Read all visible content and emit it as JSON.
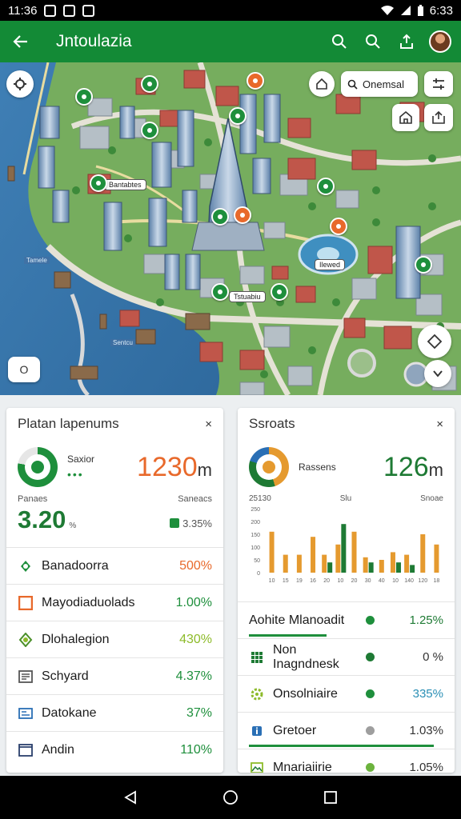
{
  "status_bar": {
    "time": "11:36",
    "clock_right": "6:33"
  },
  "app_bar": {
    "title": "Jntoulazia"
  },
  "map": {
    "search_label": "Onemsal",
    "zoom_label": "O",
    "labels": [
      "Bantabtes",
      "Tstuabiu",
      "Ilewed"
    ],
    "water_labels": [
      "Tamele",
      "Sentcu"
    ]
  },
  "left_card": {
    "title": "Platan lapenums",
    "close": "×",
    "summary_label": "Saxior",
    "summary_dots": "•••",
    "big_value": "1230",
    "big_unit": "m",
    "stat_left": "Panaes",
    "stat_right": "Saneacs",
    "kpi_value": "3.20",
    "kpi_suffix": "%",
    "kpi_right": "3.35%",
    "rows": [
      {
        "label": "Banadoorra",
        "value": "500%",
        "color": "#e8692b"
      },
      {
        "label": "Mayodiaduolads",
        "value": "1.00%",
        "color": "#1e8f3c"
      },
      {
        "label": "Dlohalegion",
        "value": "430%",
        "color": "#8dbb2a"
      },
      {
        "label": "Schyard",
        "value": "4.37%",
        "color": "#1e8f3c"
      },
      {
        "label": "Datokane",
        "value": "37%",
        "color": "#1e8f3c"
      },
      {
        "label": "Andin",
        "value": "110%",
        "color": "#1e8f3c"
      }
    ]
  },
  "right_card": {
    "title": "Ssroats",
    "close": "×",
    "summary_label": "Rassens",
    "big_value": "126",
    "big_unit": "m",
    "chart_head_left": "25130",
    "chart_head_mid": "Slu",
    "chart_head_right": "Snoae",
    "rows": [
      {
        "label": "Aohite Mlanoadit",
        "value": "1.25%",
        "dot": "#1e8f3c",
        "progress": 0.4
      },
      {
        "label": "Non Inagndnesk",
        "value": "0 %",
        "dot": "#1e7a34",
        "progress": 0
      },
      {
        "label": "Onsolniaire",
        "value": "335%",
        "dot": "#1e8f3c",
        "progress": 0
      },
      {
        "label": "Gretoer",
        "value": "1.03%",
        "dot": "#9e9e9e",
        "progress": 0.95
      },
      {
        "label": "Mnariaiirie",
        "value": "1.05%",
        "dot": "#6cb33e",
        "progress": 0
      }
    ]
  },
  "chart_data": {
    "type": "bar",
    "categories": [
      "10",
      "15",
      "19",
      "16",
      "20",
      "10",
      "20",
      "30",
      "40",
      "10",
      "140",
      "120",
      "18"
    ],
    "series": [
      {
        "values": [
          160,
          70,
          70,
          140,
          70,
          110,
          160,
          60,
          50,
          80,
          70,
          150,
          110
        ]
      },
      {
        "values": [
          0,
          0,
          0,
          0,
          40,
          190,
          0,
          40,
          0,
          40,
          30,
          0,
          0
        ]
      }
    ],
    "series_colors": [
      "#e59a2f",
      "#1e7a34"
    ],
    "y_ticks": [
      "0",
      "50",
      "100",
      "150",
      "200",
      "250"
    ],
    "ylim": [
      0,
      250
    ]
  },
  "colors": {
    "primary": "#138a36",
    "accent": "#e8692b"
  }
}
